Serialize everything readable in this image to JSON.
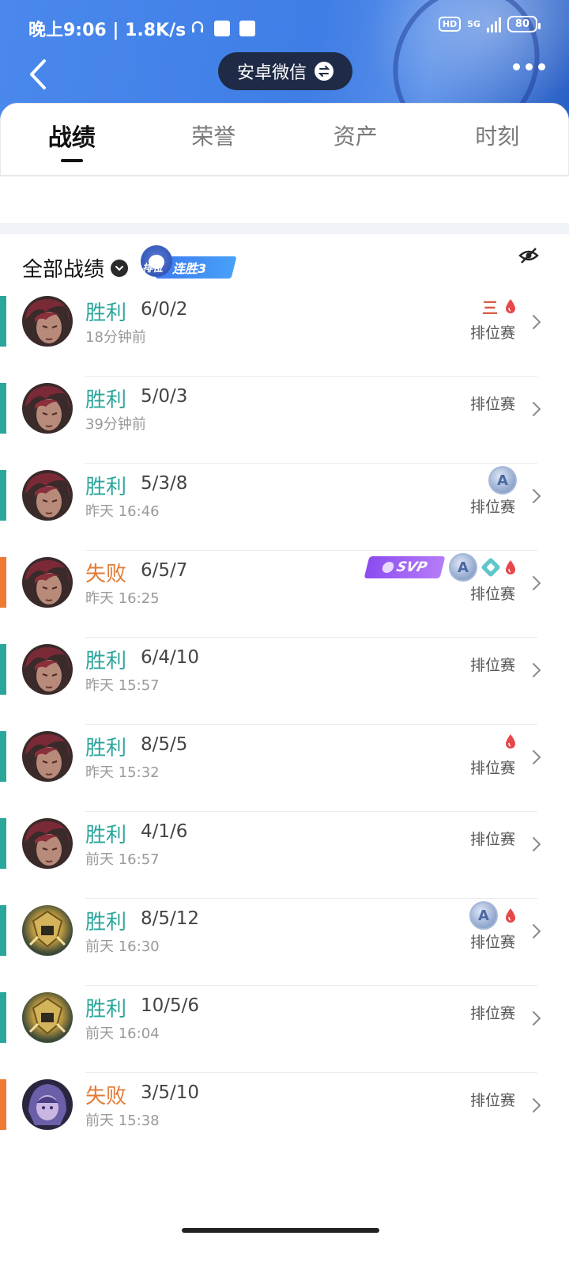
{
  "status_bar": {
    "left_text": "晚上9:06 | 1.8K/s",
    "hd": "HD",
    "network": "5G",
    "battery": "80"
  },
  "nav": {
    "account_switch_label": "安卓微信"
  },
  "tabs": [
    {
      "label": "战绩",
      "active": true
    },
    {
      "label": "荣誉",
      "active": false
    },
    {
      "label": "资产",
      "active": false
    },
    {
      "label": "时刻",
      "active": false
    }
  ],
  "section": {
    "title": "全部战绩",
    "streak_position": "排位",
    "streak_label": "连胜3"
  },
  "colors": {
    "win": "#2aa69b",
    "loss": "#e27a36",
    "accent_win": "#2aa69b",
    "accent_loss": "#ef7a33"
  },
  "matches": [
    {
      "result": "胜利",
      "outcome": "win",
      "kda": "6/0/2",
      "time": "18分钟前",
      "mode": "排位赛",
      "hero": "red-hair-hero",
      "badges": [
        "triple",
        "blood"
      ]
    },
    {
      "result": "胜利",
      "outcome": "win",
      "kda": "5/0/3",
      "time": "39分钟前",
      "mode": "排位赛",
      "hero": "red-hair-hero",
      "badges": []
    },
    {
      "result": "胜利",
      "outcome": "win",
      "kda": "5/3/8",
      "time": "昨天 16:46",
      "mode": "排位赛",
      "hero": "red-hair-hero",
      "badges": [
        "a"
      ]
    },
    {
      "result": "失败",
      "outcome": "loss",
      "kda": "6/5/7",
      "time": "昨天 16:25",
      "mode": "排位赛",
      "hero": "red-hair-hero",
      "badges": [
        "svp",
        "a",
        "shield",
        "blood"
      ]
    },
    {
      "result": "胜利",
      "outcome": "win",
      "kda": "6/4/10",
      "time": "昨天 15:57",
      "mode": "排位赛",
      "hero": "red-hair-hero",
      "badges": []
    },
    {
      "result": "胜利",
      "outcome": "win",
      "kda": "8/5/5",
      "time": "昨天 15:32",
      "mode": "排位赛",
      "hero": "red-hair-hero",
      "badges": [
        "blood"
      ]
    },
    {
      "result": "胜利",
      "outcome": "win",
      "kda": "4/1/6",
      "time": "前天 16:57",
      "mode": "排位赛",
      "hero": "red-hair-hero",
      "badges": []
    },
    {
      "result": "胜利",
      "outcome": "win",
      "kda": "8/5/12",
      "time": "前天 16:30",
      "mode": "排位赛",
      "hero": "gold-armor-hero",
      "badges": [
        "a",
        "blood"
      ]
    },
    {
      "result": "胜利",
      "outcome": "win",
      "kda": "10/5/6",
      "time": "前天 16:04",
      "mode": "排位赛",
      "hero": "gold-armor-hero",
      "badges": []
    },
    {
      "result": "失败",
      "outcome": "loss",
      "kda": "3/5/10",
      "time": "前天 15:38",
      "mode": "排位赛",
      "hero": "purple-hair-hero",
      "badges": []
    }
  ],
  "badge_text": {
    "svp": "SVP",
    "a": "A",
    "triple": "三"
  }
}
